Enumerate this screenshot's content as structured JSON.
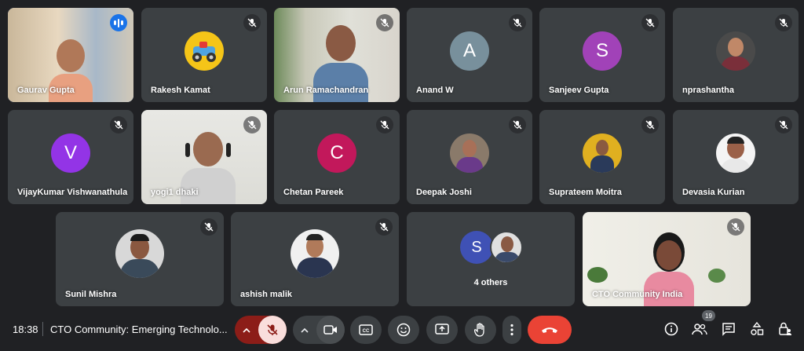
{
  "participants": [
    {
      "name": "Gaurav Gupta",
      "speaking": true
    },
    {
      "name": "Rakesh Kamat",
      "muted": true,
      "avatar_type": "photo",
      "avatar_icon": "cartoon-car-avatar-icon"
    },
    {
      "name": "Arun Ramachandran",
      "muted": true
    },
    {
      "name": "Anand W",
      "muted": true,
      "initial": "A",
      "color": "#78909c"
    },
    {
      "name": "Sanjeev Gupta",
      "muted": true,
      "initial": "S",
      "color": "#a142b8"
    },
    {
      "name": "nprashantha",
      "muted": true
    },
    {
      "name": "VijayKumar Vishwanathula",
      "muted": true,
      "initial": "V",
      "color": "#9334e6"
    },
    {
      "name": "yogi1 dhaki",
      "muted": true
    },
    {
      "name": "Chetan Pareek",
      "muted": true,
      "initial": "C",
      "color": "#c2185b"
    },
    {
      "name": "Deepak Joshi",
      "muted": true
    },
    {
      "name": "Suprateem Moitra",
      "muted": true
    },
    {
      "name": "Devasia Kurian",
      "muted": true
    },
    {
      "name": "Sunil Mishra",
      "muted": true
    },
    {
      "name": "ashish malik",
      "muted": true
    },
    {
      "name": "4 others",
      "initial": "S",
      "color": "#3f51b5"
    },
    {
      "name": "CTO Community India",
      "muted": true
    }
  ],
  "toolbar": {
    "time": "18:38",
    "meeting_title": "CTO Community: Emerging Technolo...",
    "participant_count": "19",
    "accent_red": "#ea4335",
    "mic_muted_bg": "#f9dedc"
  }
}
